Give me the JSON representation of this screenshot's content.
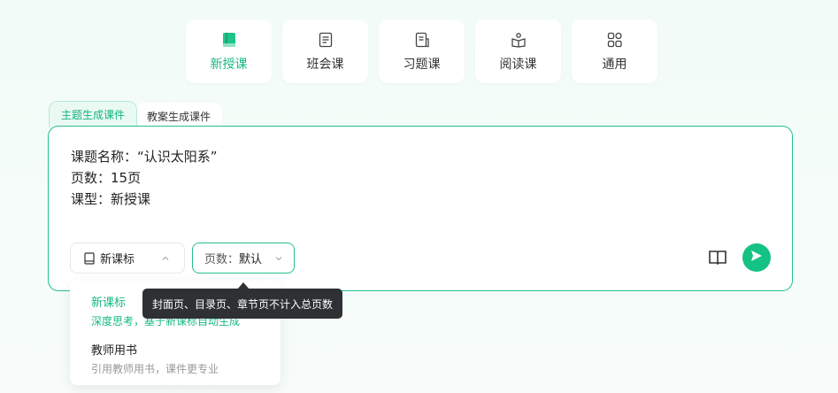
{
  "course_types": [
    {
      "label": "新授课",
      "icon": "book-filled-icon",
      "active": true
    },
    {
      "label": "班会课",
      "icon": "document-icon",
      "active": false
    },
    {
      "label": "习题课",
      "icon": "exercise-icon",
      "active": false
    },
    {
      "label": "阅读课",
      "icon": "open-book-icon",
      "active": false
    },
    {
      "label": "通用",
      "icon": "grid-icon",
      "active": false
    }
  ],
  "mode_tabs": [
    {
      "label": "主题生成课件",
      "active": true
    },
    {
      "label": "教案生成课件",
      "active": false
    }
  ],
  "prompt": {
    "line1": "课题名称：“认识太阳系”",
    "line2": "页数：15页",
    "line3": "课型：新授课"
  },
  "curriculum_select": {
    "value": "新课标",
    "icon": "book-icon"
  },
  "pages_select": {
    "label": "页数：",
    "value": "默认"
  },
  "dropdown": {
    "options": [
      {
        "title": "新课标",
        "desc": "深度思考，基于新课标自动生成",
        "selected": true
      },
      {
        "title": "教师用书",
        "desc": "引用教师用书，课件更专业",
        "selected": false
      }
    ]
  },
  "tooltip": "封面页、目录页、章节页不计入总页数",
  "colors": {
    "accent": "#16b983",
    "send": "#14c283",
    "tooltip_bg": "#2e3034"
  }
}
